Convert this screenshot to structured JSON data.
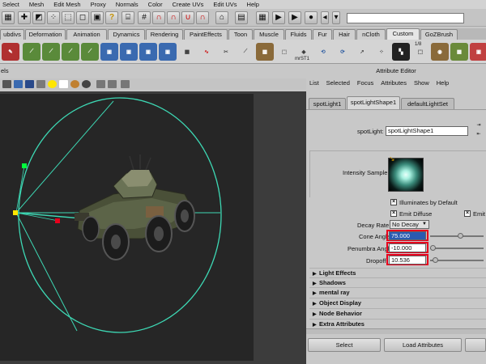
{
  "menubar": [
    "Select",
    "Mesh",
    "Edit Mesh",
    "Proxy",
    "Normals",
    "Color",
    "Create UVs",
    "Edit UVs",
    "Help"
  ],
  "shelf_tabs": [
    {
      "label": "ubdivs",
      "active": false
    },
    {
      "label": "Deformation",
      "active": false
    },
    {
      "label": "Animation",
      "active": false
    },
    {
      "label": "Dynamics",
      "active": false
    },
    {
      "label": "Rendering",
      "active": false
    },
    {
      "label": "PaintEffects",
      "active": false
    },
    {
      "label": "Toon",
      "active": false
    },
    {
      "label": "Muscle",
      "active": false
    },
    {
      "label": "Fluids",
      "active": false
    },
    {
      "label": "Fur",
      "active": false
    },
    {
      "label": "Hair",
      "active": false
    },
    {
      "label": "nCloth",
      "active": false
    },
    {
      "label": "Custom",
      "active": true
    },
    {
      "label": "GoZBrush",
      "active": false
    }
  ],
  "shelf_text": {
    "label_a": "mrST1",
    "label_b": "1/8"
  },
  "panel_head": "els",
  "ae": {
    "title": "Attribute Editor",
    "menu": [
      "List",
      "Selected",
      "Focus",
      "Attributes",
      "Show",
      "Help"
    ],
    "tabs": [
      {
        "label": "spotLight1",
        "active": false
      },
      {
        "label": "spotLightShape1",
        "active": true
      },
      {
        "label": "defaultLightSet",
        "active": false
      }
    ],
    "node_label": "spotLight:",
    "node_value": "spotLightShape1",
    "intensity_label": "Intensity Sample",
    "illuminates_label": "Illuminates by Default",
    "emit_diffuse_label": "Emit Diffuse",
    "emit_spec_label": "Emit",
    "decay_label": "Decay Rate",
    "decay_value": "No Decay",
    "cone_label": "Cone Angle",
    "cone_value": "75.000",
    "penumbra_label": "Penumbra Angle",
    "penumbra_value": "-10.000",
    "dropoff_label": "Dropoff",
    "dropoff_value": "10.536",
    "sections": [
      "Light Effects",
      "Shadows",
      "mental ray",
      "Object Display",
      "Node Behavior",
      "Extra Attributes"
    ],
    "select_button": "Select",
    "load_button": "Load Attributes"
  },
  "colors": {
    "locator_green": "#00ff3c",
    "light_yellow": "#ffe600",
    "selected_red": "#e8001c",
    "manip_cyan": "#3dd8b4"
  }
}
